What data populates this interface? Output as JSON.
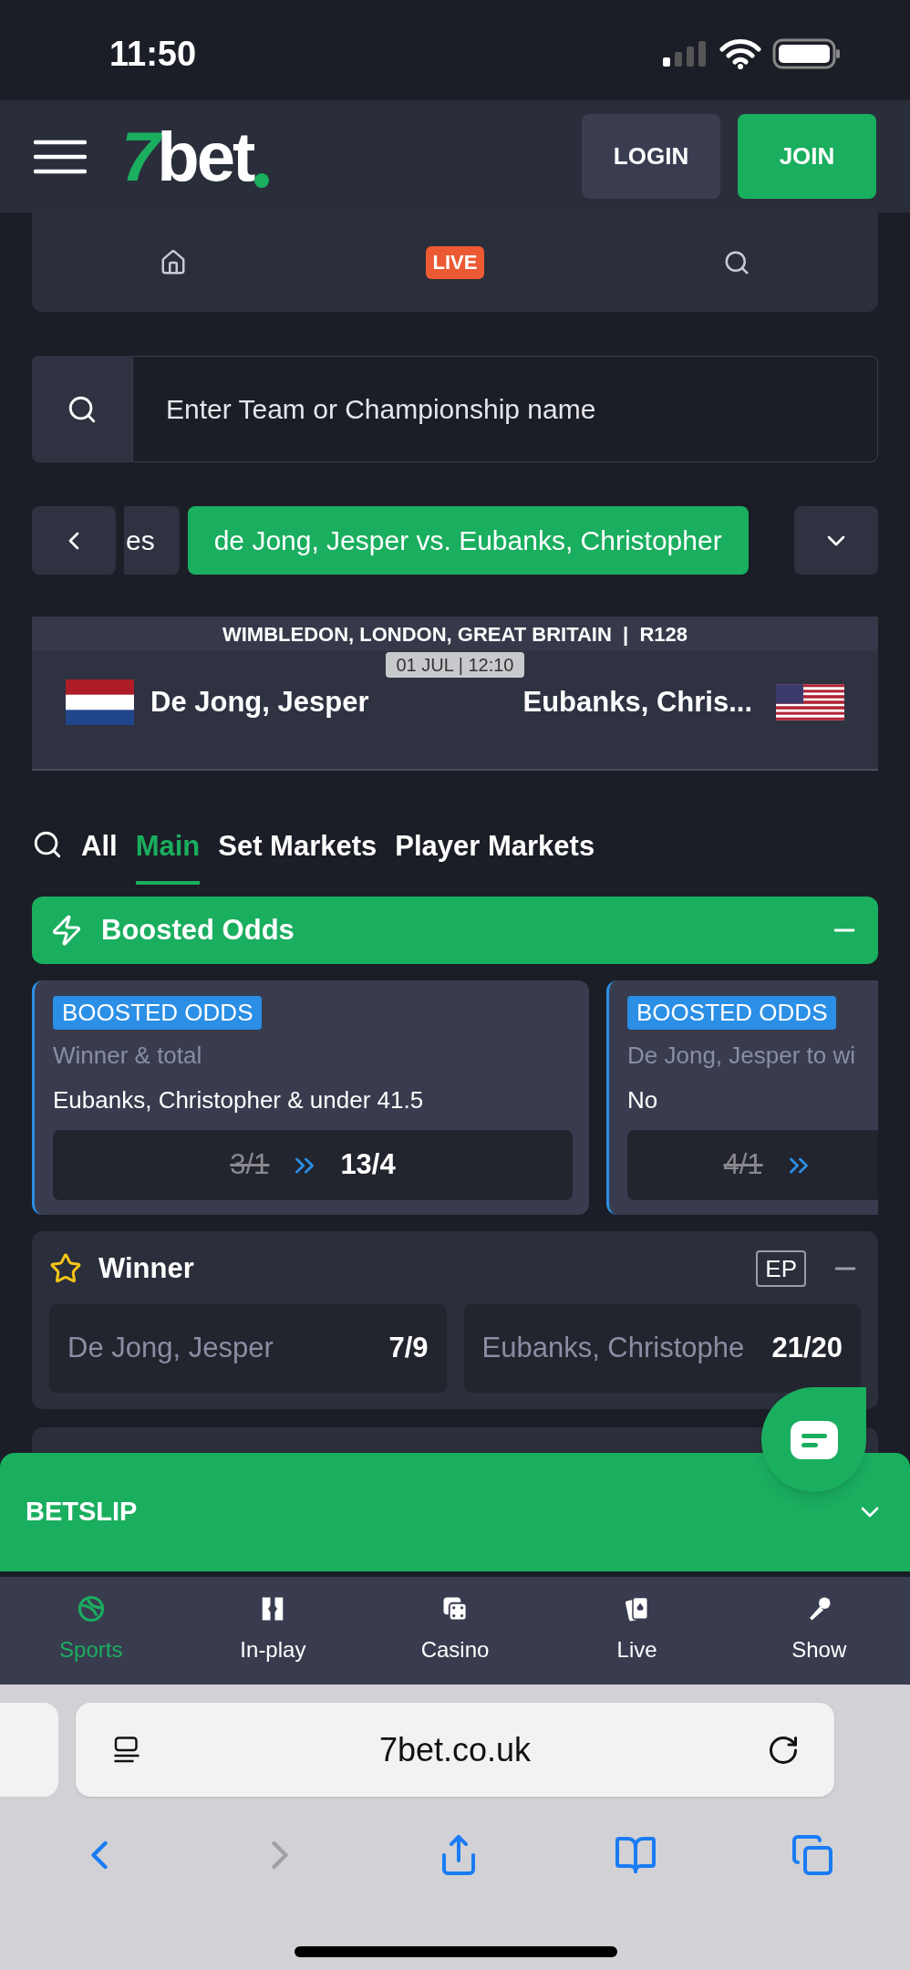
{
  "status_bar": {
    "time": "11:50"
  },
  "header": {
    "logo_number": "7",
    "logo_word": "bet",
    "buttons": [
      {
        "label": "LOGIN",
        "kind": "secondary"
      },
      {
        "label": "JOIN",
        "kind": "primary"
      }
    ]
  },
  "quick_nav": [
    {
      "kind": "home"
    },
    {
      "kind": "live",
      "label": "LIVE"
    },
    {
      "kind": "search"
    }
  ],
  "search": {
    "placeholder": "Enter Team or Championship name"
  },
  "event_tabs": [
    {
      "label": "es",
      "selected": false
    },
    {
      "label": "de Jong, Jesper vs. Eubanks, Christopher",
      "selected": true
    }
  ],
  "match": {
    "competition": "WIMBLEDON, LONDON, GREAT BRITAIN  |  R128",
    "datetime": "01 JUL | 12:10",
    "home": "De Jong, Jesper",
    "away": "Eubanks, Chris..."
  },
  "market_tabs": [
    {
      "label": "All",
      "selected": false
    },
    {
      "label": "Main",
      "selected": true
    },
    {
      "label": "Set Markets",
      "selected": false
    },
    {
      "label": "Player Markets",
      "selected": false
    }
  ],
  "boosted_section": {
    "title": "Boosted Odds",
    "expanded": true
  },
  "boosts": [
    {
      "badge": "BOOSTED ODDS",
      "market": "Winner & total",
      "selection": "Eubanks, Christopher & under 41.5",
      "old_odds": "3/1",
      "new_odds": "13/4"
    },
    {
      "badge": "BOOSTED ODDS",
      "market": "De Jong, Jesper to wi",
      "selection": "No",
      "old_odds": "4/1"
    }
  ],
  "winner": {
    "title": "Winner",
    "badge": "EP",
    "expanded": true,
    "selections": [
      {
        "name": "De Jong, Jesper",
        "odds": "7/9"
      },
      {
        "name": "Eubanks, Christophe",
        "odds": "21/20"
      }
    ]
  },
  "betslip": {
    "title": "BETSLIP"
  },
  "bottom_nav": [
    {
      "label": "Sports",
      "kind": "sports",
      "selected": true
    },
    {
      "label": "In-play",
      "kind": "inplay",
      "selected": false
    },
    {
      "label": "Casino",
      "kind": "casino",
      "selected": false
    },
    {
      "label": "Live",
      "kind": "live",
      "selected": false
    },
    {
      "label": "Show",
      "kind": "show",
      "selected": false
    }
  ],
  "browser": {
    "url": "7bet.co.uk"
  }
}
